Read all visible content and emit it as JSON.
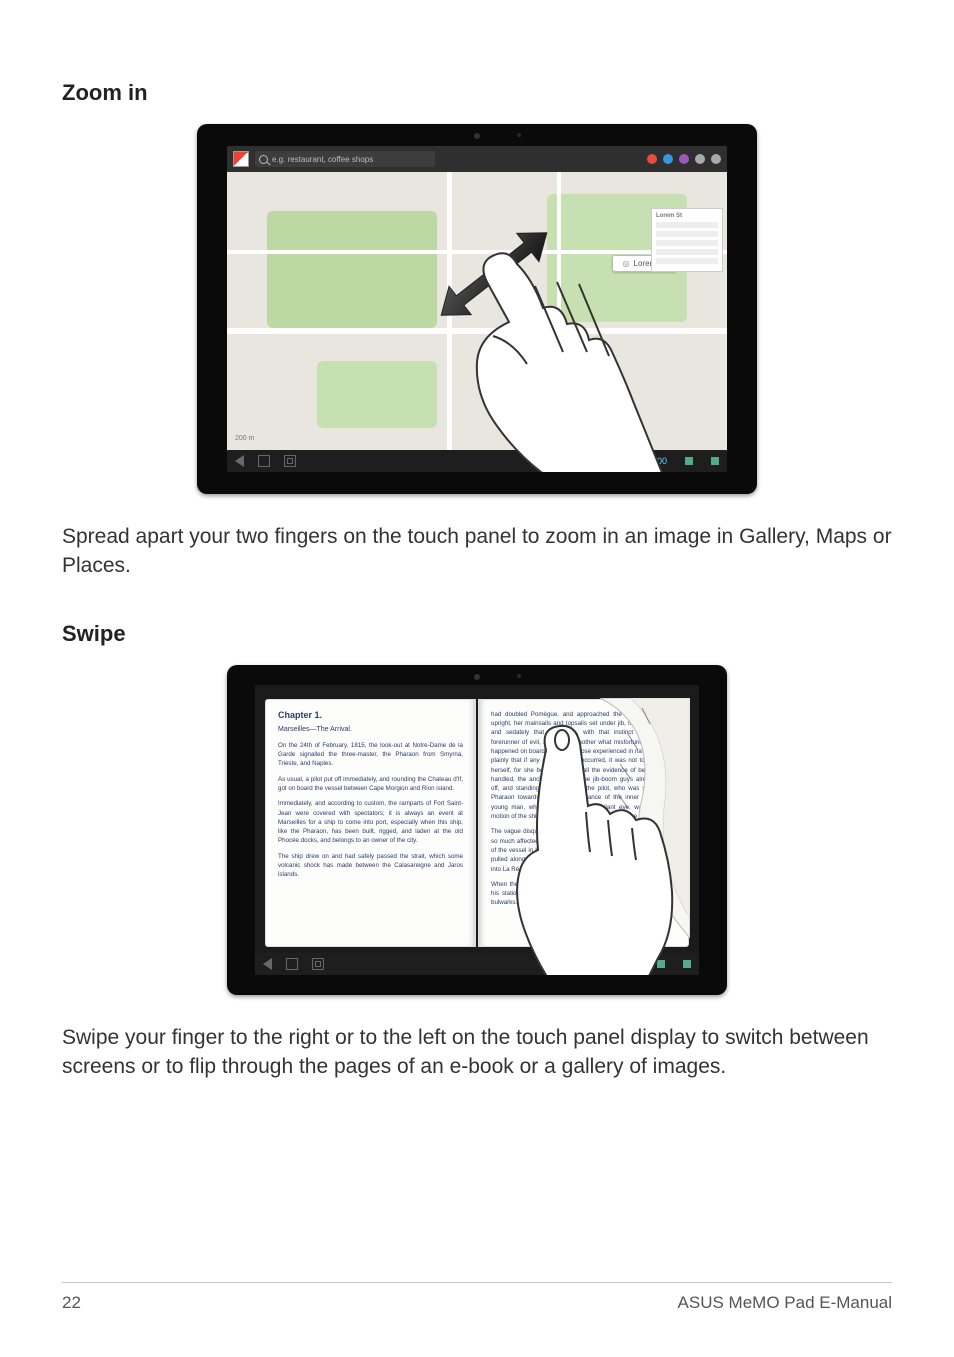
{
  "sections": {
    "zoom_heading": "Zoom in",
    "zoom_body": "Spread apart your two fingers on the touch panel to zoom in an image in Gallery, Maps or Places.",
    "swipe_heading": "Swipe",
    "swipe_body": "Swipe your finger to the right or to the left on the touch panel display to switch between screens or to flip through the pages of an e-book or a gallery of images."
  },
  "map_screen": {
    "brand": "/SUS",
    "search_placeholder": "e.g. restaurant, coffee shops",
    "popup_label": "Lorem St",
    "scale_label": "200 m",
    "clock": "12:00",
    "sidepanel_title": "Lorem St"
  },
  "ebook": {
    "chapter_title": "Chapter 1.",
    "subtitle": "Marseilles—The Arrival.",
    "left_paras": [
      "On the 24th of February, 1815, the look-out at Notre-Dame de la Garde signalled the three-master, the Pharaon from Smyrna, Trieste, and Naples.",
      "As usual, a pilot put off immediately, and rounding the Chateau d'If, got on board the vessel between Cape Morgion and Rion island.",
      "Immediately, and according to custom, the ramparts of Fort Saint-Jean were covered with spectators; it is always an event at Marseilles for a ship to come into port, especially when this ship, like the Pharaon, has been built, rigged, and laden at the old Phocée docks, and belongs to an owner of the city.",
      "The ship drew on and had safely passed the strait, which some volcanic shock has made between the Calasareigne and Jaros islands."
    ],
    "right_paras": [
      "had doubled Pomègue, and approached the harbor; calm and upright, her mainsails and topsails set under jib, moving so slowly and sedately that the idlers, with that instinct which is the forerunner of evil, asked one another what misfortune could have happened on board. However, those experienced in navigation saw plainly that if any accident had occurred, it was not to the vessel herself, for she bore down with all the evidence of being skilfully handled, the anchor a-cockbill, the jib-boom guys already eased off, and standing by the side of the pilot, who was steering the Pharaon towards the narrow entrance of the inner port, was a young man, who, with activity and vigilant eye, watched every motion of the ship, and repeated each direction of the pilot.",
      "The vague disquietude which prevailed among the spectators had so much affected one of the crowd that he did not await the arrival of the vessel in harbor, but jumping into a small skiff, desired to be pulled alongside the Pharaon, which he reached as she rounded into La Réserve basin.",
      "When the young man on board saw this person approach, he left his station by the pilot, and, hat in hand, leaned over the ship's bulwarks."
    ]
  },
  "footer": {
    "page_number": "22",
    "manual_title": "ASUS MeMO Pad E-Manual"
  }
}
